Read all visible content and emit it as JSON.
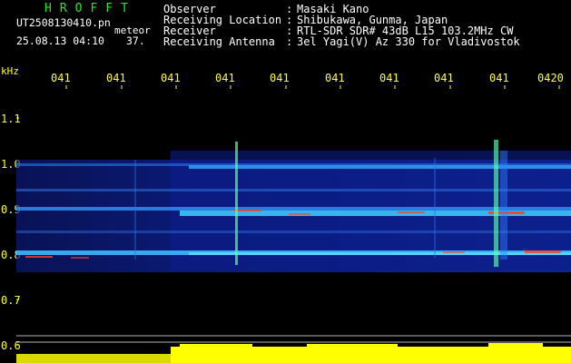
{
  "header": {
    "brand": "HROFFT",
    "filename": "UT2508130410.pn",
    "tag": "meteor",
    "timestamp": "25.08.13 04:10",
    "number": "37."
  },
  "meta": [
    {
      "label": "Observer",
      "value": "Masaki Kano"
    },
    {
      "label": "Receiving Location",
      "value": "Shibukawa, Gunma, Japan"
    },
    {
      "label": "Receiver",
      "value": "RTL-SDR SDR# 43dB L15 103.2MHz CW"
    },
    {
      "label": "Receiving Antenna",
      "value": "3el Yagi(V) Az 330 for Vladivostok"
    }
  ],
  "axis": {
    "unit": "kHz",
    "time_ticks": [
      "041",
      "041",
      "041",
      "041",
      "041",
      "041",
      "041",
      "041",
      "041",
      "0420"
    ],
    "freq_ticks": [
      {
        "label": "1.1",
        "value": 1.1
      },
      {
        "label": "1.0",
        "value": 1.0
      },
      {
        "label": "0.9",
        "value": 0.9
      },
      {
        "label": "0.8",
        "value": 0.8
      },
      {
        "label": "0.7",
        "value": 0.7
      },
      {
        "label": "0.6",
        "value": 0.6
      }
    ]
  },
  "colors": {
    "background": "#000000",
    "label": "#ffffff",
    "brand": "#22e822",
    "axis": "#ffff30",
    "signal_low": "#0a1a90",
    "signal_mid": "#2fd0ff",
    "signal_high": "#ff4020",
    "level": "#ffff00"
  }
}
